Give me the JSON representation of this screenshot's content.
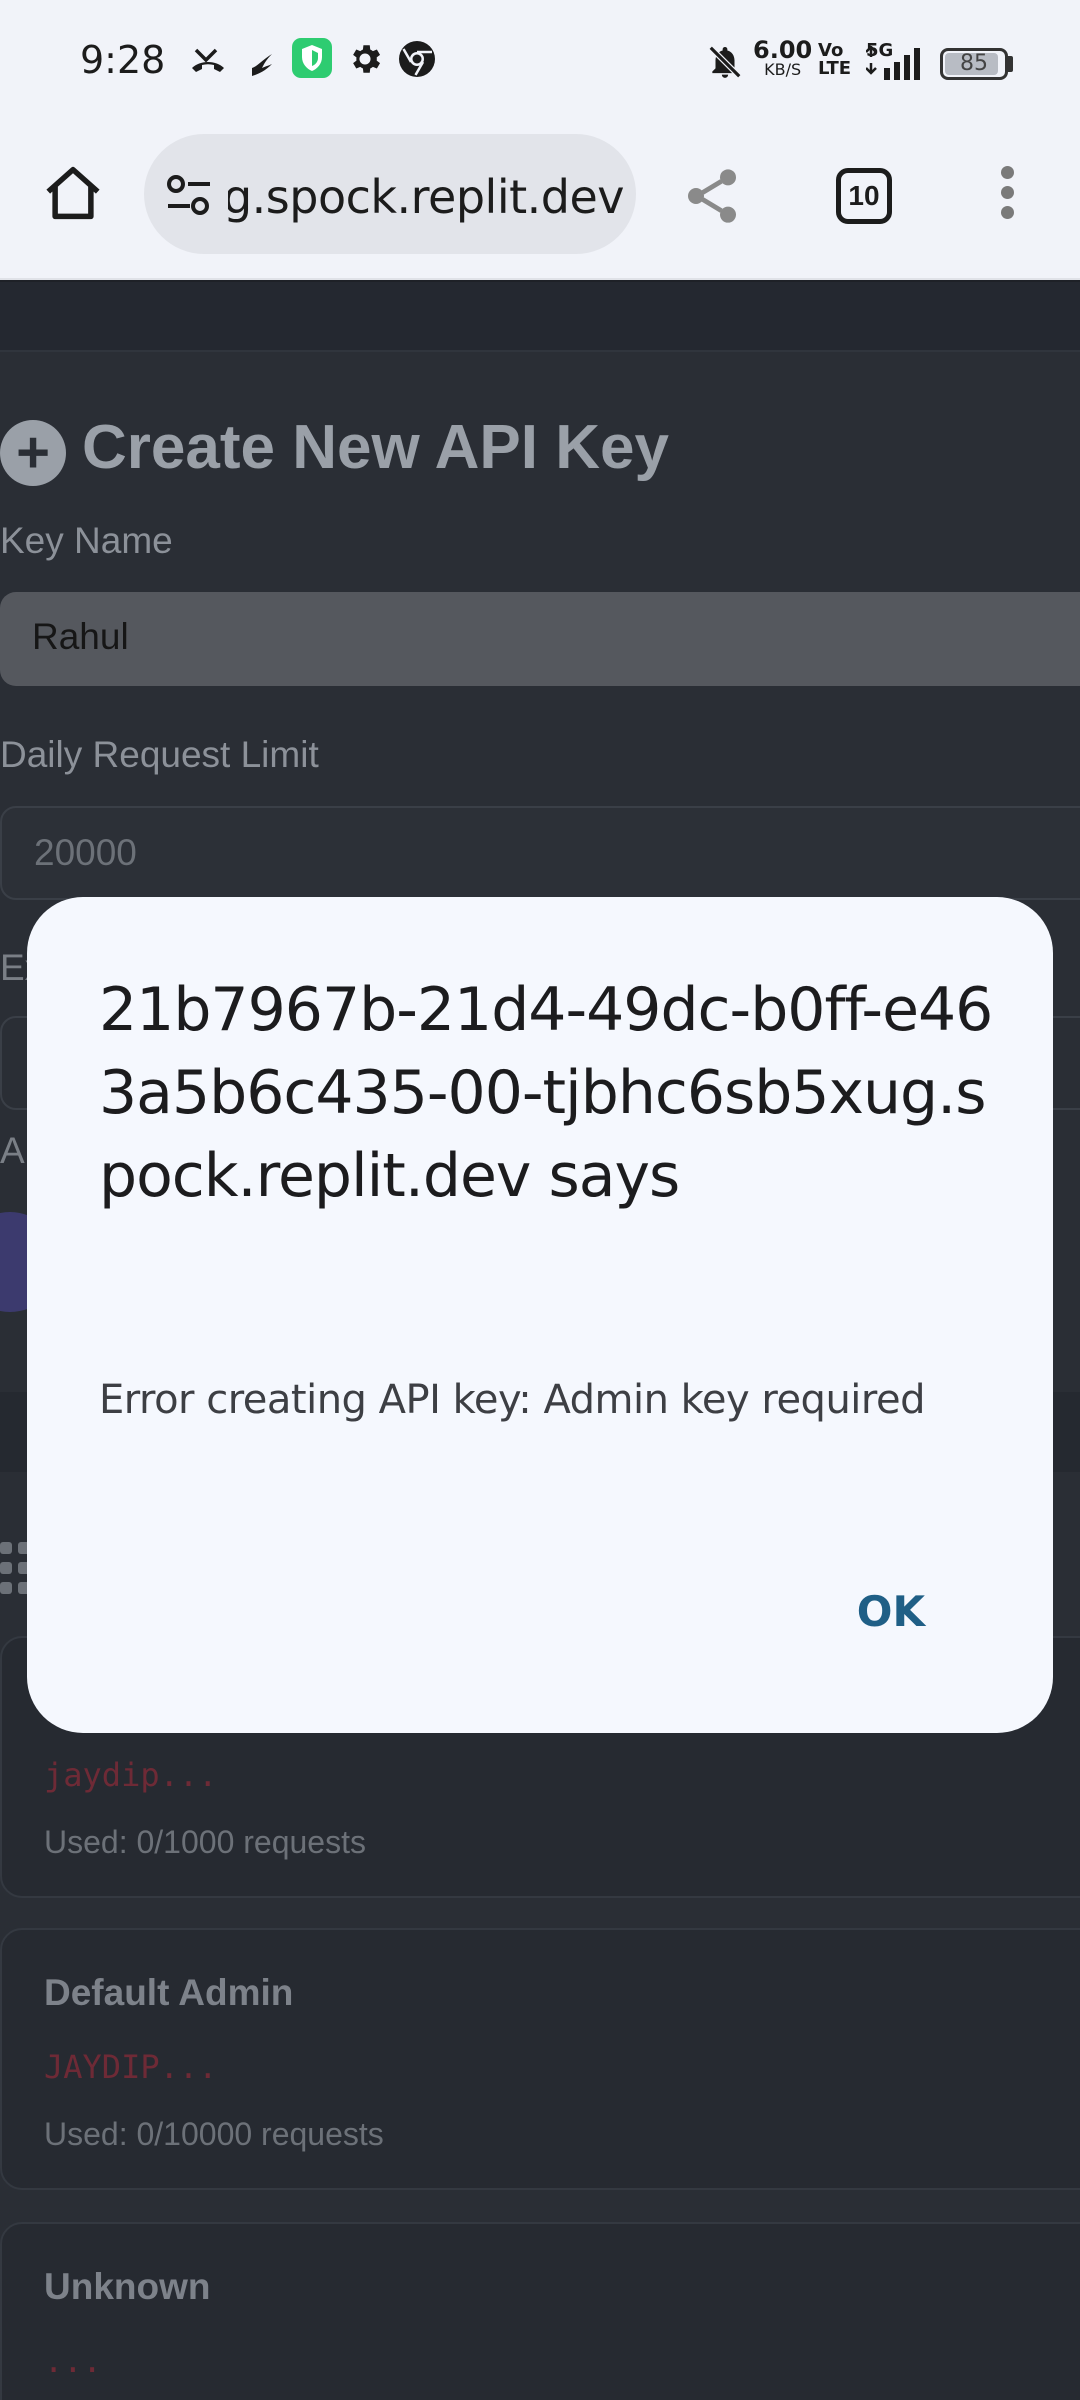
{
  "status_bar": {
    "time": "9:28",
    "net_speed": "6.00",
    "net_speed_unit": "KB/S",
    "volte_top": "Vo",
    "volte_bottom": "LTE",
    "network": "5G",
    "battery": "85",
    "icons": [
      "missed-call-icon",
      "bolt-icon",
      "vpn-shield-icon",
      "settings-gear-icon",
      "chrome-icon",
      "bell-muted-icon",
      "signal-icon"
    ]
  },
  "browser": {
    "url": "21b7967b-21d4-49dc-b0ff-e463a5b6c435-00-tjbhc6sb5xug.spock.replit.dev",
    "tab_count": "10"
  },
  "page": {
    "section_title": "Create New API Key",
    "key_name_label": "Key Name",
    "key_name_value": "Rahul",
    "daily_limit_label": "Daily Request Limit",
    "daily_limit_value": "20000",
    "partial_label_1": "Ex",
    "partial_label_2": "A",
    "cards": [
      {
        "name": "",
        "key": "jaydip...",
        "usage": "Used: 0/1000 requests"
      },
      {
        "name": "Default Admin",
        "key": "JAYDIP...",
        "usage": "Used: 0/10000 requests"
      },
      {
        "name": "Unknown",
        "key": "...",
        "usage": ""
      }
    ]
  },
  "dialog": {
    "title": "21b7967b-21d4-49dc-b0ff-e463a5b6c435-00-tjbhc6sb5xug.spock.replit.dev says",
    "message": "Error creating API key: Admin key required",
    "ok_label": "OK"
  },
  "colors": {
    "accent": "#1f5f86",
    "key_text": "#6e2a36"
  }
}
